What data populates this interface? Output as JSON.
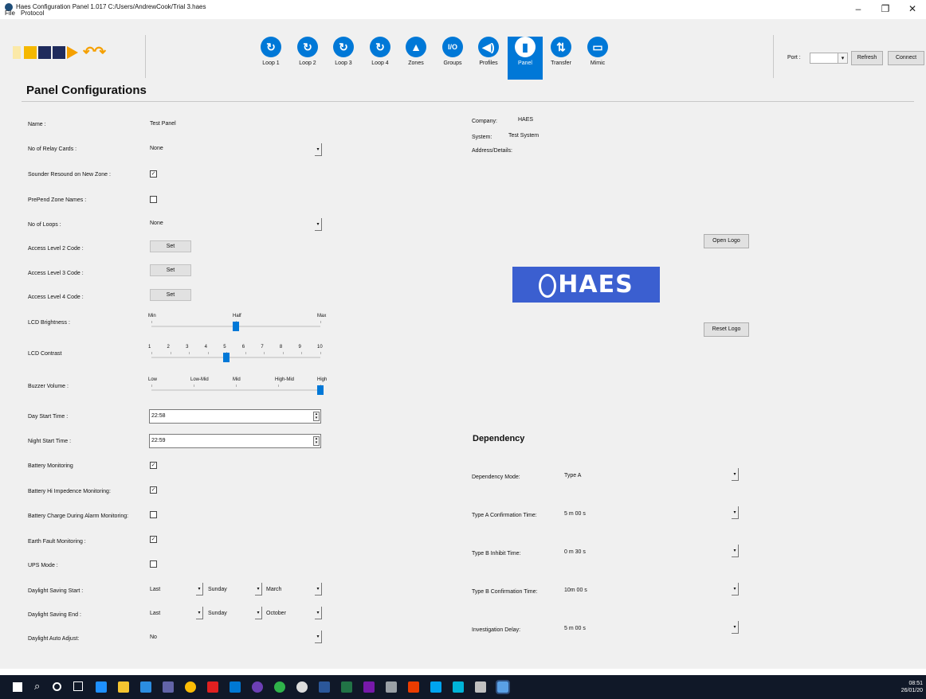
{
  "window": {
    "title": "Haes Configuration Panel 1.017   C:/Users/AndrewCook/Trial 3.haes",
    "minimize": "–",
    "maximize": "❐",
    "close": "✕"
  },
  "menu": [
    "File",
    "Protocol"
  ],
  "toolbar": {
    "file_icons": [
      "new-file-icon",
      "open-folder-icon",
      "save-icon",
      "save-as-icon",
      "send-icon",
      "undo-icon",
      "redo-icon"
    ],
    "nav": [
      {
        "label": "Loop 1",
        "icon": "↻"
      },
      {
        "label": "Loop 2",
        "icon": "↻"
      },
      {
        "label": "Loop 3",
        "icon": "↻"
      },
      {
        "label": "Loop 4",
        "icon": "↻"
      },
      {
        "label": "Zones",
        "icon": "▲"
      },
      {
        "label": "Groups",
        "icon": "I/O"
      },
      {
        "label": "Profiles",
        "icon": "◀)"
      },
      {
        "label": "Panel",
        "icon": "▮"
      },
      {
        "label": "Transfer",
        "icon": "⇅"
      },
      {
        "label": "Mimic",
        "icon": "▭"
      }
    ],
    "active": "Panel",
    "port_label": "Port :",
    "refresh": "Refresh",
    "connect": "Connect"
  },
  "page": {
    "title": "Panel Configurations",
    "fields": {
      "name_label": "Name :",
      "name_value": "Test Panel",
      "relay_label": "No of Relay Cards :",
      "relay_value": "None",
      "sounder_label": "Sounder Resound on New Zone :",
      "sounder_checked": true,
      "prepend_label": "PrePend Zone Names :",
      "prepend_checked": false,
      "loops_label": "No of Loops :",
      "loops_value": "None",
      "al2_label": "Access Level 2 Code :",
      "al3_label": "Access Level 3 Code :",
      "al4_label": "Access Level 4 Code :",
      "set_label": "Set",
      "lcd_brightness_label": "LCD Brightness :",
      "lcd_contrast_label": "LCD Contrast",
      "buzzer_label": "Buzzer Volume :",
      "day_start_label": "Day Start Time :",
      "day_start_value": "22:58",
      "night_start_label": "Night Start Time :",
      "night_start_value": "22:59",
      "battery_mon_label": "Battery Monitoring",
      "battery_mon_checked": true,
      "battery_hi_label": "Battery Hi Impedence Monitoring:",
      "battery_hi_checked": true,
      "battery_charge_label": "Battery Charge During Alarm Monitoring:",
      "battery_charge_checked": false,
      "earth_label": "Earth Fault Monitoring :",
      "earth_checked": true,
      "ups_label": "UPS Mode :",
      "ups_checked": false,
      "dst_start_label": "Daylight Saving Start :",
      "dst_start": [
        "Last",
        "Sunday",
        "March"
      ],
      "dst_end_label": "Daylight Saving End :",
      "dst_end": [
        "Last",
        "Sunday",
        "October"
      ],
      "dst_auto_label": "Daylight Auto Adjust:",
      "dst_auto_value": "No"
    },
    "sliders": {
      "brightness": {
        "ticks": [
          "Min",
          "Half",
          "Max"
        ],
        "value_fraction": 0.5
      },
      "contrast": {
        "ticks": [
          "1",
          "2",
          "3",
          "4",
          "5",
          "6",
          "7",
          "8",
          "9",
          "10"
        ],
        "value": 5
      },
      "buzzer": {
        "ticks": [
          "Low",
          "Low-Mid",
          "Mid",
          "High-Mid",
          "High"
        ],
        "value": "High"
      }
    },
    "company": {
      "company_label": "Company:",
      "company_value": "HAES",
      "system_label": "System:",
      "system_value": "Test System",
      "address_label": "Address/Details:"
    },
    "logo": {
      "open": "Open Logo",
      "reset": "Reset Logo",
      "text": "HAES"
    },
    "dependency": {
      "title": "Dependency",
      "mode_label": "Dependency Mode:",
      "mode_value": "Type A",
      "a_conf_label": "Type A Confirmation Time:",
      "a_conf_value": "5 m 00 s",
      "b_inhibit_label": "Type B Inhibit Time:",
      "b_inhibit_value": "0 m 30 s",
      "b_conf_label": "Type B Confirmation Time:",
      "b_conf_value": "10m 00 s",
      "invest_label": "Investigation Delay:",
      "invest_value": "5 m 00 s"
    }
  },
  "taskbar": {
    "time": "08:51",
    "date": "26/01/20"
  }
}
